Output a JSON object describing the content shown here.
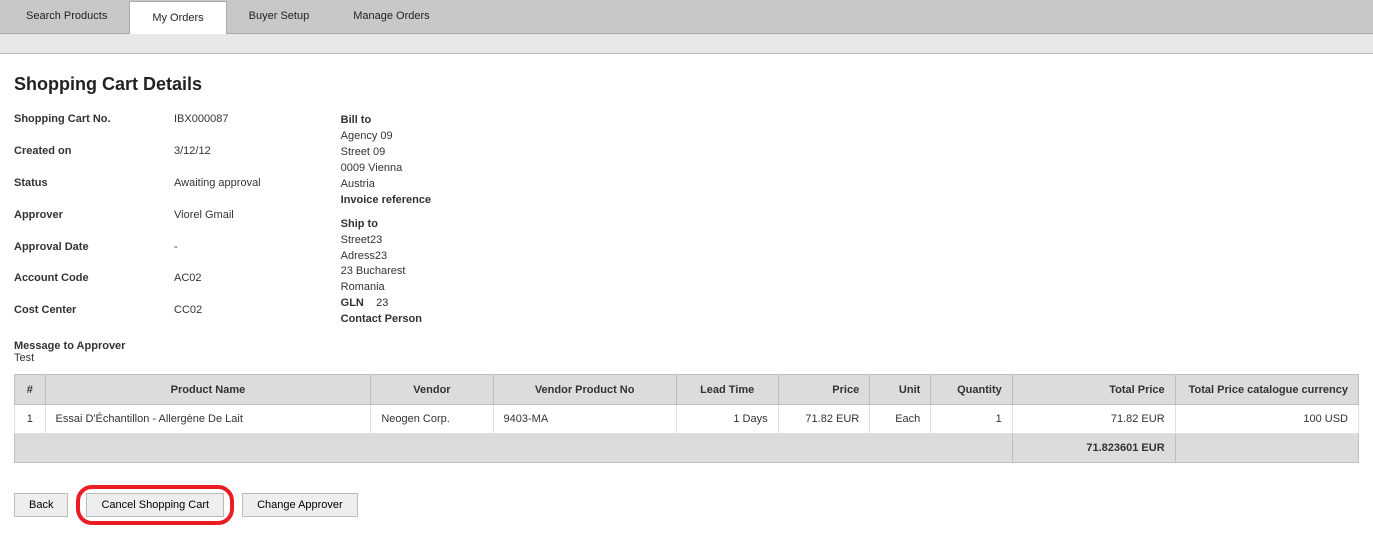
{
  "tabs": [
    "Search Products",
    "My Orders",
    "Buyer Setup",
    "Manage Orders"
  ],
  "active_tab": "My Orders",
  "page_title": "Shopping Cart Details",
  "kv": {
    "cart_no_k": "Shopping Cart No.",
    "cart_no_v": "IBX000087",
    "created_k": "Created on",
    "created_v": "3/12/12",
    "status_k": "Status",
    "status_v": "Awaiting approval",
    "approver_k": "Approver",
    "approver_v": "Viorel Gmail",
    "appr_date_k": "Approval Date",
    "appr_date_v": "-",
    "acct_k": "Account Code",
    "acct_v": "AC02",
    "cc_k": "Cost Center",
    "cc_v": "CC02"
  },
  "billto": {
    "hdr": "Bill to",
    "l1": "Agency 09",
    "l2": "Street 09",
    "l3": "0009  Vienna",
    "l4": "Austria",
    "inv_ref_hdr": "Invoice reference"
  },
  "shipto": {
    "hdr": "Ship to",
    "l1": "Street23",
    "l2": "Adress23",
    "l3": "23  Bucharest",
    "l4": "Romania",
    "gln_hdr": "GLN",
    "gln_v": "23",
    "contact_hdr": "Contact Person"
  },
  "msg_approver_hdr": "Message to Approver",
  "msg_approver_body": "Test",
  "cols": {
    "idx": "#",
    "name": "Product Name",
    "vendor": "Vendor",
    "vpn": "Vendor Product No",
    "lead": "Lead Time",
    "price": "Price",
    "unit": "Unit",
    "qty": "Quantity",
    "tprice": "Total Price",
    "tcat": "Total Price catalogue currency"
  },
  "row": {
    "idx": "1",
    "name": "Essai D'Échantillon - Allergène De Lait",
    "vendor": "Neogen Corp.",
    "vpn": "9403-MA",
    "lead": "1 Days",
    "price": "71.82 EUR",
    "unit": "Each",
    "qty": "1",
    "tprice": "71.82 EUR",
    "tcat": "100 USD"
  },
  "grand_total": "71.823601 EUR",
  "buttons": {
    "back": "Back",
    "cancel": "Cancel Shopping Cart",
    "change": "Change Approver"
  }
}
